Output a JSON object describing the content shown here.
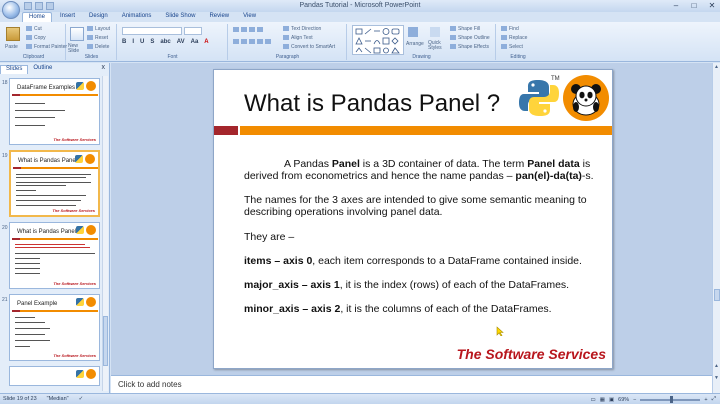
{
  "window": {
    "title": "Pandas Tutorial - Microsoft PowerPoint",
    "controls": [
      "–",
      "□",
      "✕"
    ]
  },
  "ribbon": {
    "tabs": [
      "Home",
      "Insert",
      "Design",
      "Animations",
      "Slide Show",
      "Review",
      "View"
    ],
    "active_tab": "Home",
    "clipboard": {
      "paste": "Paste",
      "cut": "Cut",
      "copy": "Copy",
      "format_painter": "Format Painter",
      "label": "Clipboard"
    },
    "slides": {
      "new_slide": "New Slide",
      "layout": "Layout",
      "reset": "Reset",
      "delete": "Delete",
      "label": "Slides"
    },
    "font": {
      "label": "Font",
      "buttons": [
        "B",
        "I",
        "U",
        "S",
        "abc",
        "AV",
        "Aa",
        "A"
      ]
    },
    "paragraph": {
      "label": "Paragraph",
      "text_direction": "Text Direction",
      "align_text": "Align Text",
      "convert_smartart": "Convert to SmartArt"
    },
    "drawing": {
      "label": "Drawing",
      "arrange": "Arrange",
      "quick_styles": "Quick Styles",
      "shape_fill": "Shape Fill",
      "shape_outline": "Shape Outline",
      "shape_effects": "Shape Effects"
    },
    "editing": {
      "label": "Editing",
      "find": "Find",
      "replace": "Replace",
      "select": "Select"
    }
  },
  "left_pane": {
    "tabs": [
      "Slides",
      "Outline"
    ],
    "close": "x",
    "thumbnails": [
      {
        "num": "18",
        "title": "DataFrame Examples",
        "selected": false
      },
      {
        "num": "19",
        "title": "What is Pandas Panel ?",
        "selected": true
      },
      {
        "num": "20",
        "title": "What is Pandas Panel ?",
        "selected": false
      },
      {
        "num": "21",
        "title": "Panel Example",
        "selected": false
      }
    ],
    "thumb_brand": "The Software Services"
  },
  "slide": {
    "title": "What is Pandas Panel ?",
    "tm": "TM",
    "p1_pre": "A Pandas ",
    "p1_b1": "Panel",
    "p1_mid": " is a 3D container of data. The term ",
    "p1_b2": "Panel data",
    "p1_mid2": " is derived from econometrics and hence the name pandas – ",
    "p1_b3": "pan(el)-da(ta)",
    "p1_end": "-s.",
    "p2": "The names for the 3 axes are intended to give some semantic meaning to describing operations involving panel data.",
    "p3": "They are –",
    "i1_b": "items – axis 0",
    "i1_t": ", each item corresponds to a DataFrame contained inside.",
    "i2_b": "major_axis – axis 1",
    "i2_t": ", it is the index (rows) of each of the DataFrames.",
    "i3_b": "minor_axis – axis 2",
    "i3_t": ", it is the columns of each of the DataFrames.",
    "brand": "The Software Services"
  },
  "notes": {
    "placeholder": "Click to add notes"
  },
  "status": {
    "slide_count": "Slide 19 of 23",
    "theme": "\"Median\"",
    "zoom": "69%",
    "zoom_fraction": 0.5
  },
  "colors": {
    "orange": "#f28c00",
    "red_bar": "#a4262c",
    "brand_red": "#b8161d",
    "ribbon_bg": "#d4e3f5"
  }
}
